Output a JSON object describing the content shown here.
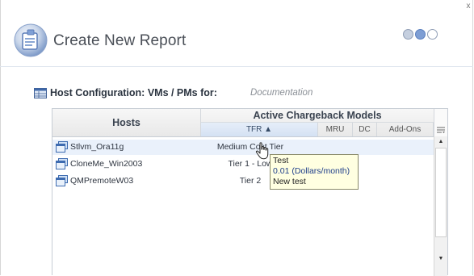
{
  "window": {
    "close_glyph": "x"
  },
  "header": {
    "title": "Create New Report",
    "logo_icon": "report-wizard-icon",
    "steps": [
      {
        "state": "done"
      },
      {
        "state": "current"
      },
      {
        "state": "pending"
      }
    ]
  },
  "section": {
    "icon": "grid-icon",
    "title": "Host Configuration: VMs / PMs for:",
    "subtitle": "Documentation"
  },
  "table": {
    "hosts_header": "Hosts",
    "group_header": "Active Chargeback Models",
    "columns": [
      {
        "label": "TFR ▲",
        "sorted": true
      },
      {
        "label": "MRU",
        "sorted": false
      },
      {
        "label": "DC",
        "sorted": false
      },
      {
        "label": "Add-Ons",
        "sorted": false
      }
    ],
    "rows": [
      {
        "host": "Stlvm_Ora11g",
        "tfr": "Medium Cost Tier",
        "selected": true
      },
      {
        "host": "CloneMe_Win2003",
        "tfr": "Tier 1 - Low",
        "selected": false
      },
      {
        "host": "QMPremoteW03",
        "tfr": "Tier 2",
        "selected": false
      }
    ]
  },
  "tooltip": {
    "lines": [
      "Test",
      "0.01 (Dollars/month)",
      "New test"
    ]
  },
  "colors": {
    "accent": "#6d8fc9",
    "selected_row": "#eaf1fb",
    "tooltip_bg": "#ffffe1"
  }
}
